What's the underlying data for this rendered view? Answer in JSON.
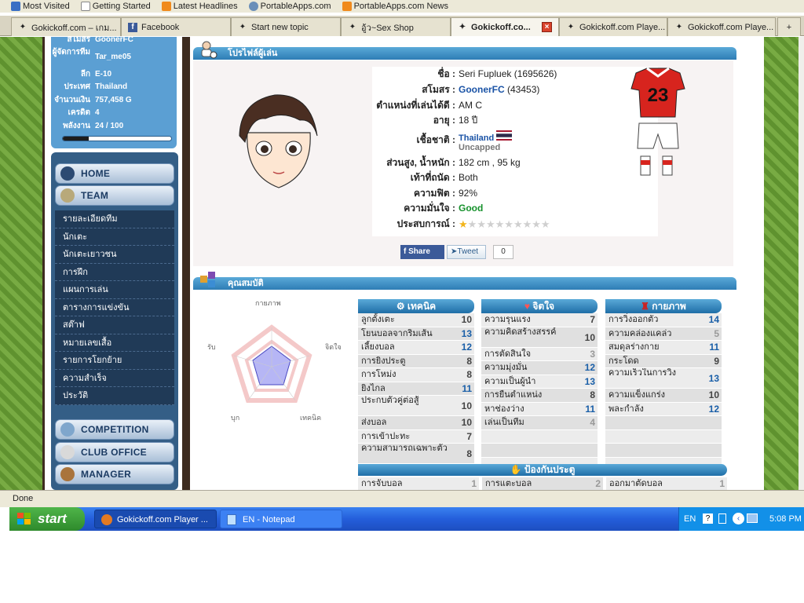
{
  "bookmarks": [
    {
      "label": "Most Visited"
    },
    {
      "label": "Getting Started"
    },
    {
      "label": "Latest Headlines"
    },
    {
      "label": "PortableApps.com"
    },
    {
      "label": "PortableApps.com News"
    }
  ],
  "tabs": [
    {
      "label": "Gokickoff.com – เกม..."
    },
    {
      "label": "Facebook"
    },
    {
      "label": "Start new topic"
    },
    {
      "label": "อู้ว~Sex Shop"
    },
    {
      "label": "Gokickoff.co..."
    },
    {
      "label": "Gokickoff.com Playe..."
    },
    {
      "label": "Gokickoff.com Playe..."
    }
  ],
  "user_info": {
    "club_label": "สโมสร",
    "club_value": "GoonerFC",
    "manager_label": "ผู้จัดการทีม",
    "manager_value": "Tar_me05",
    "league_label": "ลีก",
    "league_value": "E-10",
    "country_label": "ประเทศ",
    "country_value": "Thailand",
    "money_label": "จำนวนเงิน",
    "money_value": "757,458 G",
    "credit_label": "เครดิต",
    "credit_value": "4",
    "energy_label": "พลังงาน",
    "energy_value": "24 / 100",
    "energy_fraction": 0.24
  },
  "nav": {
    "home": "HOME",
    "team": "TEAM",
    "sub_items": [
      "รายละเอียดทีม",
      "นักเตะ",
      "นักเตะเยาวชน",
      "การฝึก",
      "แผนการเล่น",
      "ตารางการแข่งขัน",
      "สต๊าฟ",
      "หมายเลขเสื้อ",
      "รายการโยกย้าย",
      "ความสำเร็จ",
      "ประวัติ"
    ],
    "competition": "COMPETITION",
    "club_office": "CLUB OFFICE",
    "manager": "MANAGER"
  },
  "profile": {
    "section_title": "โปรไฟล์ผู้เล่น",
    "name_label": "ชื่อ :",
    "name_value": "Seri Fupluek (1695626)",
    "club_label": "สโมสร :",
    "club_value": "GoonerFC",
    "club_id": "(43453)",
    "position_label": "ตำแหน่งที่เล่นได้ดี :",
    "position_value": "AM C",
    "age_label": "อายุ :",
    "age_value": "18 ปี",
    "nationality_label": "เชื้อชาติ :",
    "nationality_value": "Thailand",
    "capped_value": "Uncapped",
    "height_weight_label": "ส่วนสูง, น้ำหนัก :",
    "height_weight_value": "182 cm , 95 kg",
    "foot_label": "เท้าที่ถนัด :",
    "foot_value": "Both",
    "fitness_label": "ความฟิต :",
    "fitness_value": "92%",
    "morale_label": "ความมั่นใจ :",
    "morale_value": "Good",
    "experience_label": "ประสบการณ์ :",
    "experience_stars": 1,
    "experience_max": 10,
    "shirt_number": "23",
    "share_label": "Share",
    "tweet_label": "Tweet",
    "tweet_count": "0"
  },
  "attributes": {
    "section_title": "คุณสมบัติ",
    "radar_labels": {
      "top": "กายภาพ",
      "right": "จิตใจ",
      "bottom_right": "เทคนิค",
      "bottom_left": "บุก",
      "left": "รับ"
    },
    "technical": {
      "title": "เทคนิค",
      "rows": [
        {
          "name": "ลูกตั้งเตะ",
          "value": "10"
        },
        {
          "name": "โยนบอลจากริมเส้น",
          "value": "13"
        },
        {
          "name": "เลี้ยงบอล",
          "value": "12"
        },
        {
          "name": "การยิงประตู",
          "value": "8"
        },
        {
          "name": "การโหม่ง",
          "value": "8"
        },
        {
          "name": "ยิงไกล",
          "value": "11"
        },
        {
          "name": "ประกบตัวคู่ต่อสู้",
          "value": "10"
        },
        {
          "name": "ส่งบอล",
          "value": "10"
        },
        {
          "name": "การเข้าปะทะ",
          "value": "7"
        },
        {
          "name": "ความสามารถเฉพาะตัว",
          "value": "8"
        }
      ]
    },
    "mental": {
      "title": "จิตใจ",
      "rows": [
        {
          "name": "ความรุนแรง",
          "value": "7"
        },
        {
          "name": "ความคิดสร้างสรรค์",
          "value": "10"
        },
        {
          "name": "การตัดสินใจ",
          "value": "3"
        },
        {
          "name": "ความมุ่งมั่น",
          "value": "12"
        },
        {
          "name": "ความเป็นผู้นำ",
          "value": "13"
        },
        {
          "name": "การยืนตำแหน่ง",
          "value": "8"
        },
        {
          "name": "หาช่องว่าง",
          "value": "11"
        },
        {
          "name": "เล่นเป็นทีม",
          "value": "4"
        }
      ]
    },
    "physical": {
      "title": "กายภาพ",
      "rows": [
        {
          "name": "การวิ่งออกตัว",
          "value": "14"
        },
        {
          "name": "ความคล่องแคล่ว",
          "value": "5"
        },
        {
          "name": "สมดุลร่างกาย",
          "value": "11"
        },
        {
          "name": "กระโดด",
          "value": "9"
        },
        {
          "name": "ความเร็วในการวิ่ง",
          "value": "13"
        },
        {
          "name": "ความแข็งแกร่ง",
          "value": "10"
        },
        {
          "name": "พละกำลัง",
          "value": "12"
        }
      ]
    },
    "goalkeeping": {
      "title": "ป้องกันประตู",
      "rows": [
        {
          "name": "การจับบอล",
          "value": "1"
        },
        {
          "name": "การแตะบอล",
          "value": "2"
        },
        {
          "name": "ออกมาตัดบอล",
          "value": "1"
        }
      ]
    }
  },
  "status": "Done",
  "taskbar": {
    "start": "start",
    "items": [
      {
        "label": "Gokickoff.com Player ..."
      },
      {
        "label": "EN - Notepad"
      }
    ],
    "lang": "EN",
    "time": "5:08 PM"
  },
  "colors": {
    "accent": "#2e7db5",
    "good": "#15912b",
    "nav": "#345e86"
  }
}
